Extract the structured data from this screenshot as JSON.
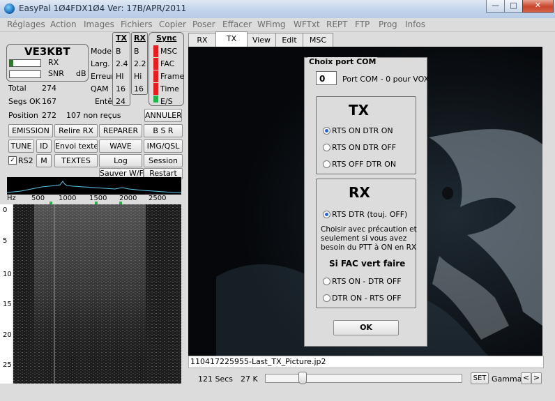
{
  "window": {
    "title": "EasyPal  1Ø4FDX1Ø4   Ver: 17B/APR/2011",
    "min_glyph": "—",
    "max_glyph": "□",
    "close_glyph": "✕"
  },
  "menu": [
    "Réglages",
    "Action",
    "Images",
    "Fichiers",
    "Copier",
    "Poser",
    "Effacer",
    "WFimg",
    "WFTxt",
    "REPT",
    "FTP",
    "Prog",
    "Infos"
  ],
  "station": {
    "callsign": "VE3KBT",
    "rx_label": "RX",
    "snr_label": "SNR",
    "snr_unit": "dB",
    "rx_level": 0.12,
    "snr_level": 0.0
  },
  "params": {
    "labels": [
      "Mode",
      "Larg.",
      "Erreur",
      "QAM",
      "Entête"
    ],
    "tx_header": "TX",
    "rx_header": "RX",
    "tx_values": [
      "B",
      "2.4",
      "HI",
      "16",
      "24"
    ],
    "rx_values": [
      "B",
      "2.2",
      "Hi",
      "16",
      ""
    ]
  },
  "sync": {
    "header": "Sync",
    "items": [
      "MSC",
      "FAC",
      "Frame",
      "Time",
      "E/S"
    ],
    "colors": [
      "#e21f1f",
      "#e21f1f",
      "#e21f1f",
      "#e21f1f",
      "#22b14c"
    ]
  },
  "stats": {
    "total_label": "Total",
    "total_value": "274",
    "segs_label": "Segs OK",
    "segs_value": "167",
    "position_label": "Position",
    "position_value": "272",
    "missing_text": "107 non reçus"
  },
  "buttons": {
    "annuler": "ANNULER",
    "emission": "EMISSION",
    "relire": "Relire RX",
    "reparer": "REPARER",
    "bsr": "B S R",
    "tune": "TUNE",
    "id": "ID",
    "envoi": "Envoi texte",
    "wave": "WAVE",
    "imgqsl": "IMG/QSL",
    "rs2": "RS2",
    "m": "M",
    "textes": "TEXTES",
    "log": "Log",
    "session": "Session",
    "sauver": "Sauver W/F",
    "restart": "Restart"
  },
  "freq_scale": {
    "unit": "Hz",
    "ticks": [
      "500",
      "1000",
      "1500",
      "2000",
      "2500"
    ]
  },
  "waterfall_scale": [
    "0",
    "5",
    "10",
    "15",
    "20",
    "25"
  ],
  "tabs": [
    "RX",
    "TX",
    "View",
    "Edit",
    "MSC"
  ],
  "active_tab": "TX",
  "dialog": {
    "title": "Choix port COM",
    "port_value": "0",
    "port_label": "Port COM - 0 pour VOX",
    "tx_heading": "TX",
    "tx_options": [
      "RTS ON   DTR ON",
      "RTS ON   DTR OFF",
      "RTS OFF  DTR ON"
    ],
    "tx_selected": 0,
    "rx_heading": "RX",
    "rx_option": "RTS DTR (touj. OFF)",
    "warning_lines": [
      "Choisir avec précaution et",
      "seulement si vous avez",
      "besoin du PTT à ON en RX"
    ],
    "fac_heading": "Si FAC vert faire",
    "fac_options": [
      "RTS ON - DTR OFF",
      "DTR ON - RTS OFF"
    ],
    "ok_label": "OK"
  },
  "status": {
    "filename": "110417225955-Last_TX_Picture.jp2",
    "secs": "121 Secs",
    "size": "27 K",
    "set_label": "SET",
    "gamma_label": "Gamma",
    "prev_glyph": "<",
    "next_glyph": ">",
    "slider_position": 0.19
  }
}
